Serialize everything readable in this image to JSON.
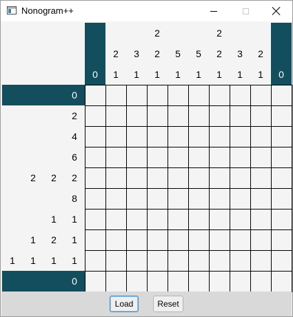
{
  "window": {
    "title": "Nonogram++"
  },
  "puzzle": {
    "column_clues": [
      [
        "0"
      ],
      [
        "2",
        "1"
      ],
      [
        "3",
        "1"
      ],
      [
        "2",
        "2",
        "1"
      ],
      [
        "5",
        "1"
      ],
      [
        "5",
        "1"
      ],
      [
        "2",
        "2",
        "1"
      ],
      [
        "3",
        "1"
      ],
      [
        "2",
        "1"
      ],
      [
        "0"
      ]
    ],
    "row_clues": [
      [
        "0"
      ],
      [
        "2"
      ],
      [
        "4"
      ],
      [
        "6"
      ],
      [
        "2",
        "2",
        "2"
      ],
      [
        "8"
      ],
      [
        "1",
        "1"
      ],
      [
        "1",
        "2",
        "1"
      ],
      [
        "1",
        "1",
        "1",
        "1"
      ],
      [
        "0"
      ]
    ],
    "highlighted_columns": [
      0,
      9
    ],
    "highlighted_rows": [
      0,
      9
    ],
    "filled_cells": []
  },
  "colors": {
    "highlight": "#134e5e",
    "cell_background": "#f4f4f4",
    "grid_line": "#000000"
  },
  "buttons": {
    "load_label": "Load",
    "reset_label": "Reset"
  }
}
